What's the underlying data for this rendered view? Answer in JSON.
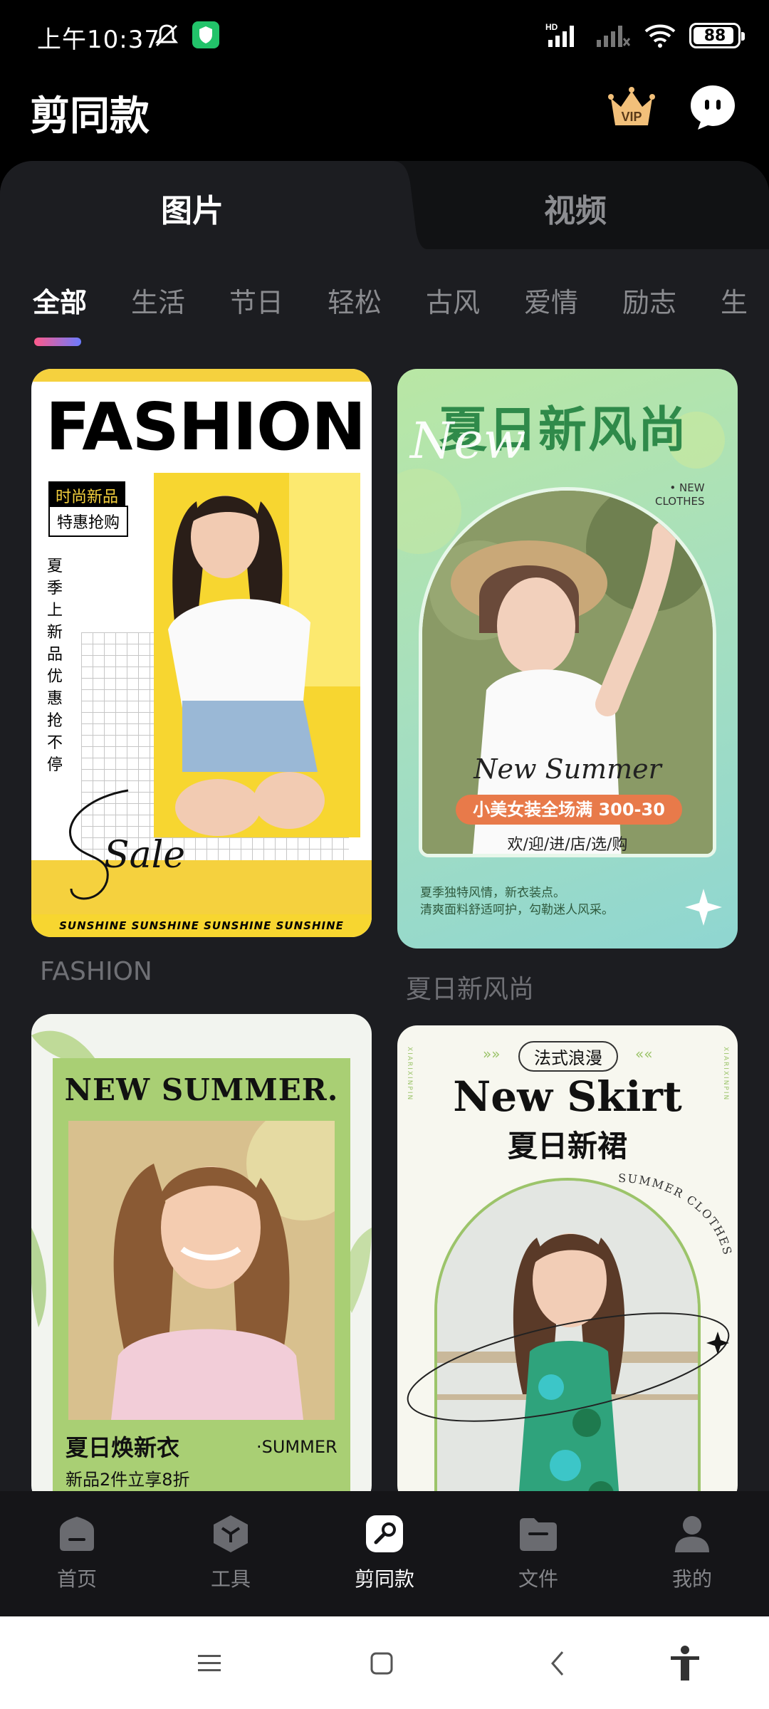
{
  "status_bar": {
    "time": "上午10:37",
    "battery": "88",
    "network_label": "HD"
  },
  "header": {
    "title": "剪同款",
    "vip_label": "VIP"
  },
  "segments": {
    "active": "图片",
    "inactive": "视频"
  },
  "categories": [
    "全部",
    "生活",
    "节日",
    "轻松",
    "古风",
    "爱情",
    "励志",
    "生"
  ],
  "cards": [
    {
      "caption": "FASHION",
      "headline": "FASHION",
      "tag1": "时尚新品",
      "tag2": "特惠抢购",
      "vertical_text": "夏季上新品优惠抢不停",
      "script_text": "Sale",
      "strip_text": "SUNSHINE SUNSHINE SUNSHINE SUNSHINE"
    },
    {
      "caption": "夏日新风尚",
      "headline": "夏日新风尚",
      "overlay": "New",
      "new_clothes": "• NEW\nCLOTHES",
      "subtitle": "New Summer",
      "pill": "小美女装全场满 300-30",
      "welcome": "欢/迎/进/店/选/购",
      "desc_line1": "夏季独特风情，新衣装点。",
      "desc_line2": "清爽面料舒适呵护，勾勒迷人风采。"
    },
    {
      "headline": "NEW SUMMER.",
      "cn_title": "夏日焕新衣",
      "summer": "·SUMMER",
      "promo": "新品2件立享8折"
    },
    {
      "pill": "法式浪漫",
      "headline": "New Skirt",
      "cn_title": "夏日新裙",
      "arc_text": "SUMMER CLOTHES",
      "side_text": "XIARIXINPIN"
    }
  ],
  "bottom_nav": [
    {
      "label": "首页",
      "icon": "home-icon"
    },
    {
      "label": "工具",
      "icon": "tools-icon"
    },
    {
      "label": "剪同款",
      "icon": "template-icon"
    },
    {
      "label": "文件",
      "icon": "folder-icon"
    },
    {
      "label": "我的",
      "icon": "profile-icon"
    }
  ],
  "colors": {
    "background": "#000000",
    "panel": "#1c1d21",
    "accent_gradient_start": "#ff5a8a",
    "accent_gradient_end": "#6b7bff",
    "inactive_text": "#8a8b8f"
  }
}
